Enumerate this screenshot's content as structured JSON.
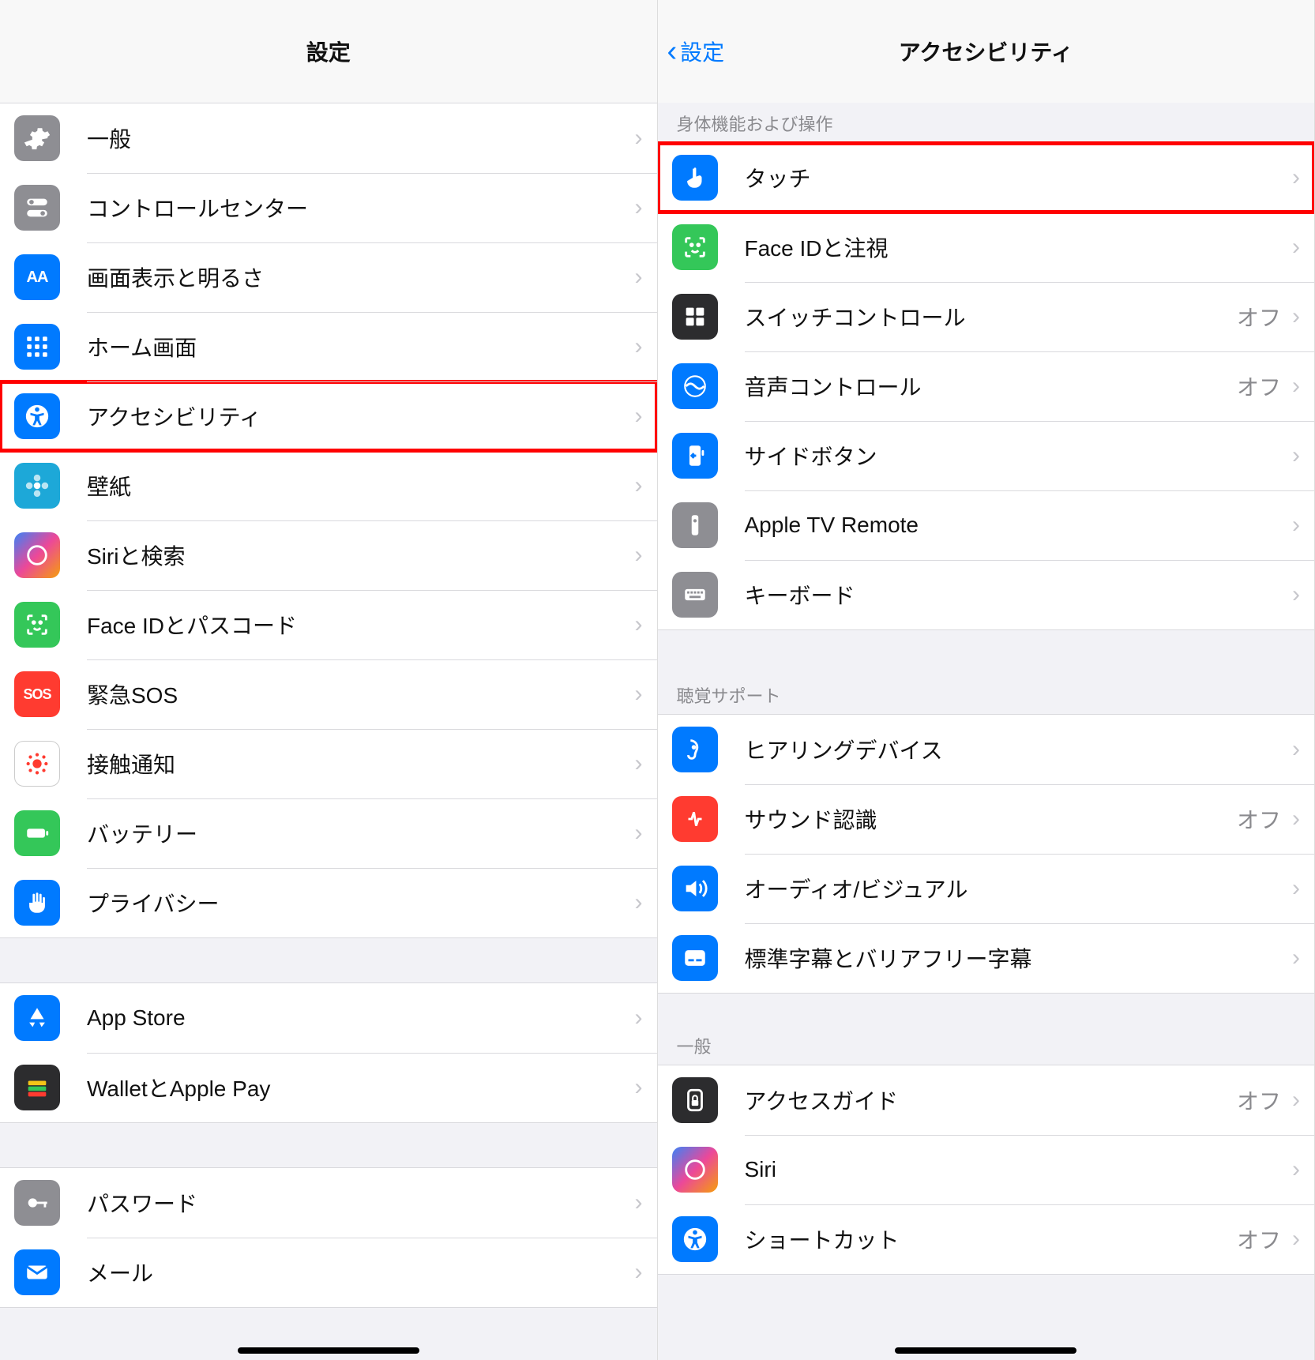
{
  "left": {
    "title": "設定",
    "items": [
      {
        "label": "一般"
      },
      {
        "label": "コントロールセンター"
      },
      {
        "label": "画面表示と明るさ"
      },
      {
        "label": "ホーム画面"
      },
      {
        "label": "アクセシビリティ"
      },
      {
        "label": "壁紙"
      },
      {
        "label": "Siriと検索"
      },
      {
        "label": "Face IDとパスコード"
      },
      {
        "label": "緊急SOS"
      },
      {
        "label": "接触通知"
      },
      {
        "label": "バッテリー"
      },
      {
        "label": "プライバシー"
      }
    ],
    "items2": [
      {
        "label": "App Store"
      },
      {
        "label": "WalletとApple Pay"
      }
    ],
    "items3": [
      {
        "label": "パスワード"
      },
      {
        "label": "メール"
      }
    ]
  },
  "right": {
    "back": "設定",
    "title": "アクセシビリティ",
    "section1": "身体機能および操作",
    "items1": [
      {
        "label": "タッチ"
      },
      {
        "label": "Face IDと注視"
      },
      {
        "label": "スイッチコントロール",
        "value": "オフ"
      },
      {
        "label": "音声コントロール",
        "value": "オフ"
      },
      {
        "label": "サイドボタン"
      },
      {
        "label": "Apple TV Remote"
      },
      {
        "label": "キーボード"
      }
    ],
    "section2": "聴覚サポート",
    "items2": [
      {
        "label": "ヒアリングデバイス"
      },
      {
        "label": "サウンド認識",
        "value": "オフ"
      },
      {
        "label": "オーディオ/ビジュアル"
      },
      {
        "label": "標準字幕とバリアフリー字幕"
      }
    ],
    "section3": "一般",
    "items3": [
      {
        "label": "アクセスガイド",
        "value": "オフ"
      },
      {
        "label": "Siri"
      },
      {
        "label": "ショートカット",
        "value": "オフ"
      }
    ]
  }
}
